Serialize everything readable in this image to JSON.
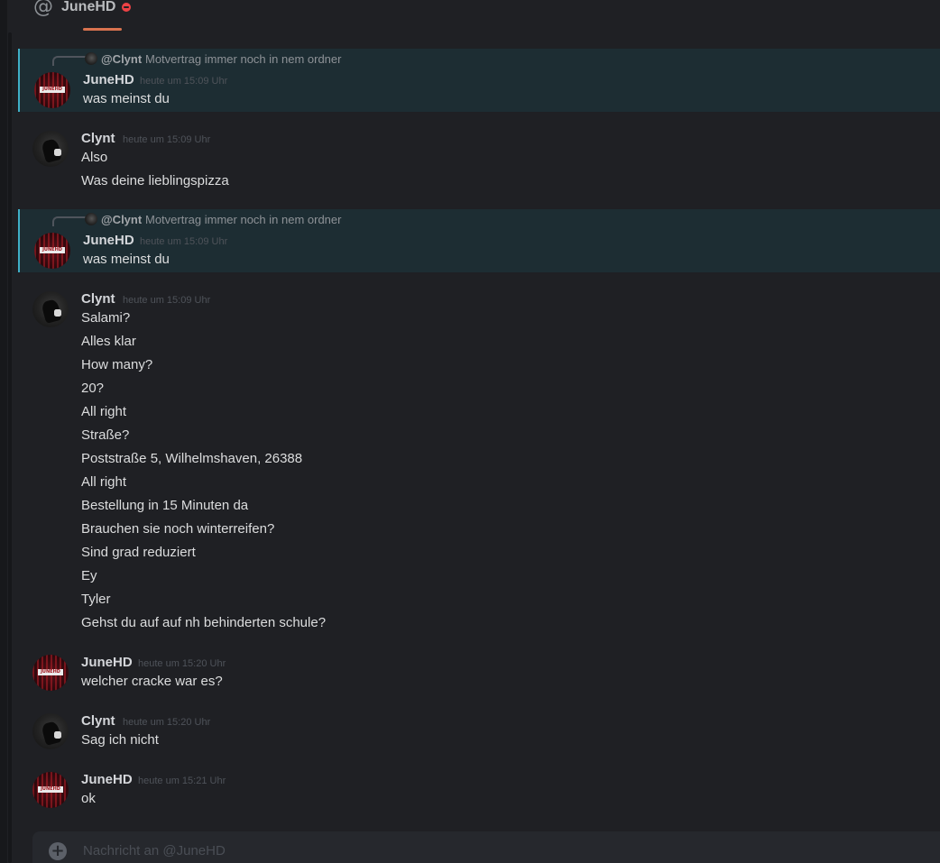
{
  "header": {
    "title": "JuneHD"
  },
  "messages": [
    {
      "id": "m1",
      "reply": {
        "author": "@Clynt",
        "text": "Motvertrag immer noch in nem ordner"
      },
      "author": "JuneHD",
      "timestamp": "heute um 15:09 Uhr",
      "lines": [
        "was meinst du"
      ]
    },
    {
      "id": "m2",
      "author": "Clynt",
      "timestamp": "heute um 15:09 Uhr",
      "lines": [
        "Also",
        "Was deine lieblingspizza"
      ]
    },
    {
      "id": "m3",
      "reply": {
        "author": "@Clynt",
        "text": "Motvertrag immer noch in nem ordner"
      },
      "author": "JuneHD",
      "timestamp": "heute um 15:09 Uhr",
      "lines": [
        "was meinst du"
      ]
    },
    {
      "id": "m4",
      "author": "Clynt",
      "timestamp": "heute um 15:09 Uhr",
      "lines": [
        "Salami?",
        "Alles klar",
        "How many?",
        "20?",
        "All right",
        "Straße?",
        "Poststraße 5, Wilhelmshaven, 26388",
        "All right",
        "Bestellung in 15 Minuten da",
        "Brauchen sie noch winterreifen?",
        "Sind grad reduziert",
        "Ey",
        "Tyler",
        "Gehst du auf auf nh behinderten schule?"
      ]
    },
    {
      "id": "m5",
      "author": "JuneHD",
      "timestamp": "heute um 15:20 Uhr",
      "lines": [
        "welcher cracke war es?"
      ]
    },
    {
      "id": "m6",
      "author": "Clynt",
      "timestamp": "heute um 15:20 Uhr",
      "lines": [
        "Sag ich nicht"
      ]
    },
    {
      "id": "m7",
      "author": "JuneHD",
      "timestamp": "heute um 15:21 Uhr",
      "lines": [
        "ok"
      ]
    }
  ],
  "avatar_badge": "JUNEHD",
  "composer": {
    "placeholder": "Nachricht an @JuneHD"
  },
  "colors": {
    "accent_underline": "#d9734f",
    "highlight_bar": "#3fb0c8",
    "highlight_bg": "#1d2d33",
    "dnd": "#ed4245"
  }
}
